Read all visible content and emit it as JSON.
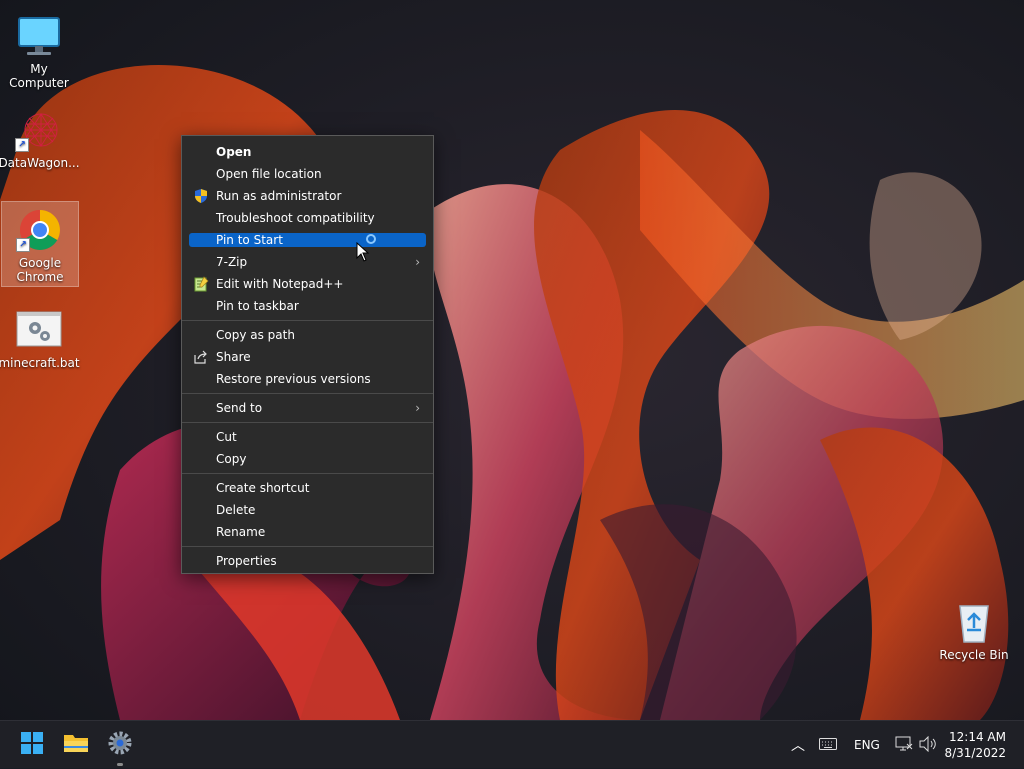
{
  "desktop": {
    "icons": [
      {
        "label": "My Computer",
        "icon": "monitor-icon"
      },
      {
        "label": "DataWagon...",
        "icon": "datawagon-icon"
      },
      {
        "label": "Google Chrome",
        "icon": "chrome-icon"
      },
      {
        "label": "minecraft.bat",
        "icon": "batch-file-icon"
      },
      {
        "label": "Recycle Bin",
        "icon": "recycle-bin-icon"
      }
    ]
  },
  "context_menu": {
    "items": [
      {
        "label": "Open"
      },
      {
        "label": "Open file location"
      },
      {
        "label": "Run as administrator",
        "icon": "uac-shield-icon"
      },
      {
        "label": "Troubleshoot compatibility"
      },
      {
        "label": "Pin to Start"
      },
      {
        "label": "7-Zip"
      },
      {
        "label": "Edit with Notepad++",
        "icon": "notepad-plus-icon"
      },
      {
        "label": "Pin to taskbar"
      },
      {
        "label": "Copy as path"
      },
      {
        "label": "Share",
        "icon": "share-icon"
      },
      {
        "label": "Restore previous versions"
      },
      {
        "label": "Send to"
      },
      {
        "label": "Cut"
      },
      {
        "label": "Copy"
      },
      {
        "label": "Create shortcut"
      },
      {
        "label": "Delete"
      },
      {
        "label": "Rename"
      },
      {
        "label": "Properties"
      }
    ],
    "highlight_color": "#0a64c8"
  },
  "taskbar": {
    "language": "ENG",
    "time": "12:14 AM",
    "date": "8/31/2022"
  }
}
